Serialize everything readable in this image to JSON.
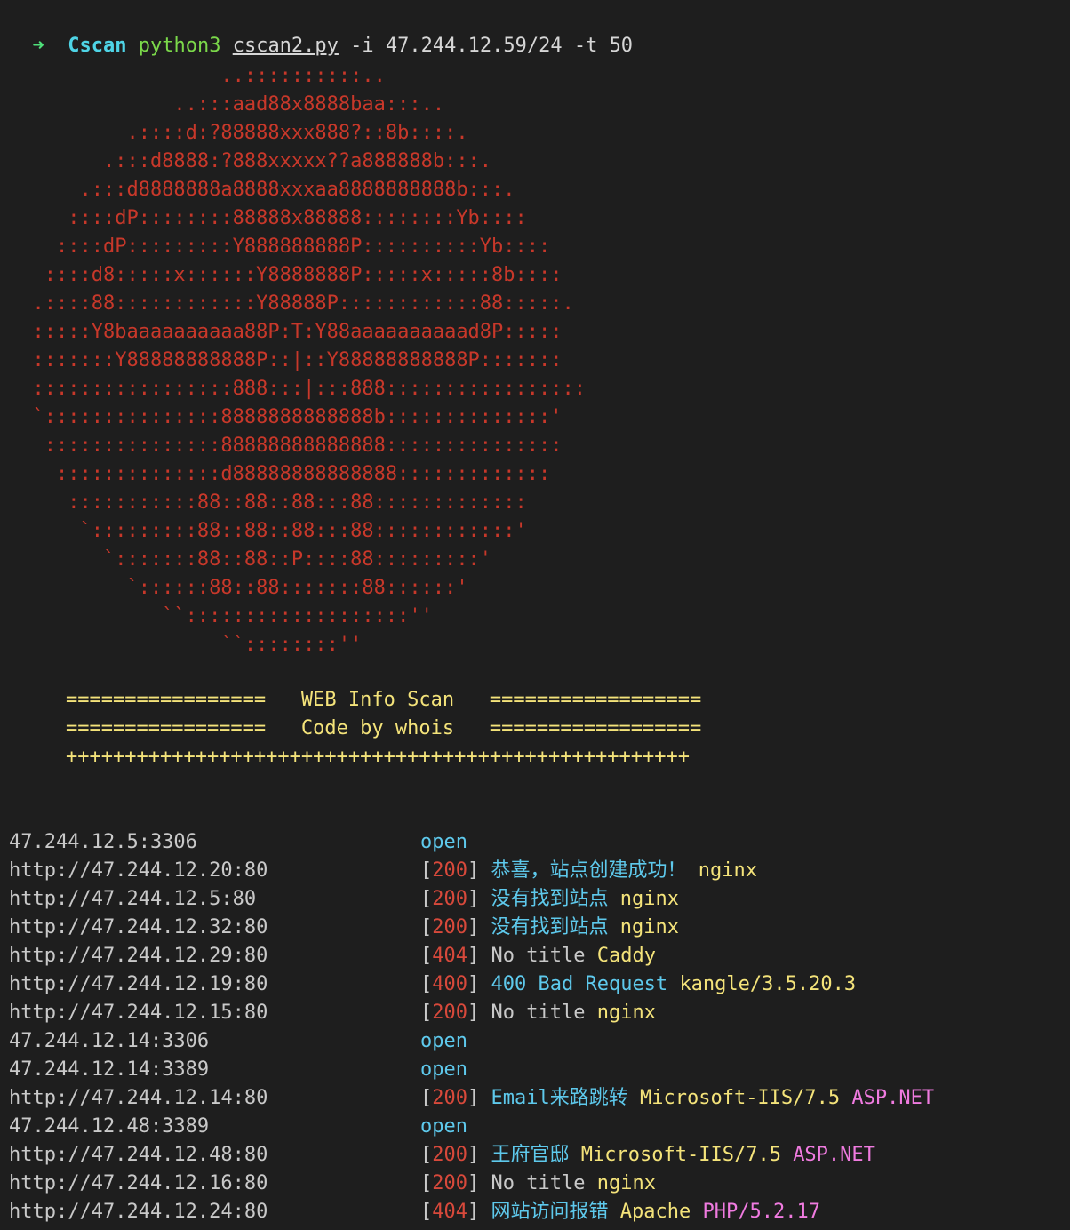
{
  "command": {
    "arrow": "➜",
    "dir": "Cscan",
    "interpreter": "python3",
    "script": "cscan2.py",
    "args": "-i 47.244.12.59/24 -t 50"
  },
  "banner_art": "                  ..::::::::::..\n              ..:::aad88x8888baa:::..\n          .::::d:?88888xxx888?::8b::::.\n        .:::d8888:?888xxxxx??a888888b:::.\n      .:::d8888888a8888xxxaa8888888888b:::.\n     ::::dP::::::::88888x88888::::::::Yb::::\n    ::::dP:::::::::Y888888888P::::::::::Yb::::\n   ::::d8:::::x::::::Y8888888P:::::x:::::8b::::\n  .::::88::::::::::::Y88888P::::::::::::88:::::. \n  :::::Y8baaaaaaaaaa88P:T:Y88aaaaaaaaaad8P:::::\n  :::::::Y88888888888P::|::Y88888888888P:::::::\n  :::::::::::::::::888:::|:::888:::::::::::::::::\n  `:::::::::::::::8888888888888b::::::::::::::'\n   :::::::::::::::88888888888888:::::::::::::::\n    ::::::::::::::d88888888888888:::::::::::::\n     :::::::::::88::88::88:::88:::::::::::::\n      `:::::::::88::88::88:::88::::::::::::'\n        `:::::::88::88::P::::88:::::::::'\n          `::::::88::88:::::::88::::::'\n             ``:::::::::::::::::::'' \n                  ``::::::::''",
  "header": {
    "line1_left": "=================",
    "line1_title": "WEB Info Scan",
    "line1_right": "==================",
    "line2_left": "=================",
    "line2_title": "Code by whois",
    "line2_right": "==================",
    "line3": "+++++++++++++++++++++++++++++++++++++++++++++++++++++"
  },
  "results": [
    {
      "host": "47.244.12.5:3306",
      "status": "open"
    },
    {
      "host": "http://47.244.12.20:80",
      "code": "200",
      "title": "恭喜，站点创建成功！",
      "server": "nginx"
    },
    {
      "host": "http://47.244.12.5:80",
      "code": "200",
      "title": "没有找到站点",
      "server": "nginx"
    },
    {
      "host": "http://47.244.12.32:80",
      "code": "200",
      "title": "没有找到站点",
      "server": "nginx"
    },
    {
      "host": "http://47.244.12.29:80",
      "code": "404",
      "title": "No title",
      "server": "Caddy"
    },
    {
      "host": "http://47.244.12.19:80",
      "code": "400",
      "title": "400 Bad Request",
      "server": "kangle/3.5.20.3"
    },
    {
      "host": "http://47.244.12.15:80",
      "code": "200",
      "title": "No title",
      "server": "nginx"
    },
    {
      "host": "47.244.12.14:3306",
      "status": "open"
    },
    {
      "host": "47.244.12.14:3389",
      "status": "open"
    },
    {
      "host": "http://47.244.12.14:80",
      "code": "200",
      "title": "Email来路跳转",
      "server": "Microsoft-IIS/7.5",
      "extra": "ASP.NET"
    },
    {
      "host": "47.244.12.48:3389",
      "status": "open"
    },
    {
      "host": "http://47.244.12.48:80",
      "code": "200",
      "title": "王府官邸",
      "server": "Microsoft-IIS/7.5",
      "extra": "ASP.NET"
    },
    {
      "host": "http://47.244.12.16:80",
      "code": "200",
      "title": "No title",
      "server": "nginx"
    },
    {
      "host": "http://47.244.12.24:80",
      "code": "404",
      "title": "网站访问报错",
      "server": "Apache",
      "extra": "PHP/5.2.17"
    }
  ],
  "colors": {
    "background": "#1e1e1e",
    "banner_red": "#c8382a",
    "header_yellow": "#f4e37a",
    "status_cyan": "#5ec9ec",
    "code_red": "#d8493b",
    "server_yellow": "#f4e37a",
    "extra_magenta": "#f07be0",
    "prompt_green": "#4fe07a"
  }
}
